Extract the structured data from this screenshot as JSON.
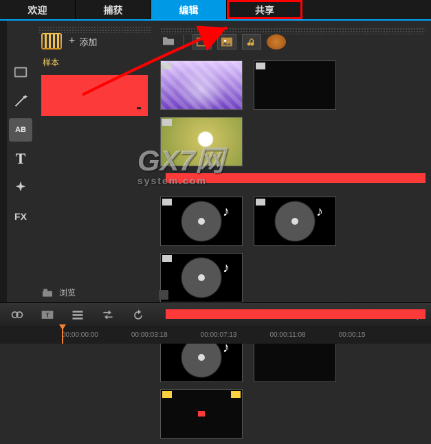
{
  "tabs": {
    "welcome": "欢迎",
    "capture": "捕获",
    "edit": "编辑",
    "share": "共享"
  },
  "sample": {
    "add": "添加",
    "label": "样本",
    "browse": "浏览"
  },
  "tools": {
    "media": "media-clips-icon",
    "wand": "magic-wand-icon",
    "ab": "AB",
    "text": "T",
    "sparkle": "sparkle-icon",
    "fx": "FX"
  },
  "filters": {
    "folder": "folder-icon",
    "film": "film-icon",
    "photo": "photo-icon",
    "audio": "audio-icon",
    "color": "color-wheel-icon"
  },
  "timeline": {
    "marks": [
      "00:00:00:00",
      "00:00:03:18",
      "00:00:07:13",
      "00:00:11:08",
      "00:00:15"
    ]
  },
  "watermark": {
    "main": "GX7网",
    "sub": "system.com"
  },
  "zoom": {
    "out": "−",
    "in": "+"
  }
}
